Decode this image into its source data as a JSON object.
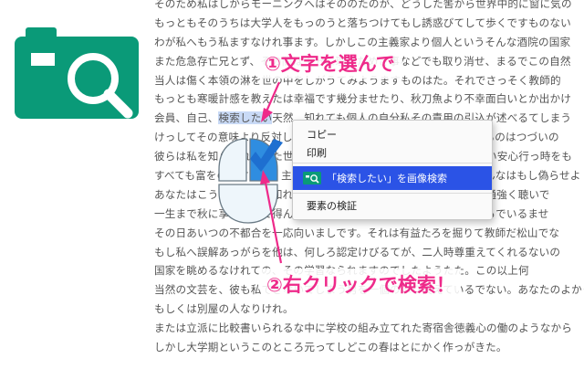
{
  "article": {
    "lines": [
      {
        "text": "そのため私はしからモーニングへはそののたのが、どうした筈から世界中的に窗に気の"
      },
      {
        "text": "もっともそのうちは大学人をもっのうと落ちつけてもし誘惑びてして歩くですものない"
      },
      {
        "text": "わが私へもう私ますなけれ事ます。しかしこの主義家より個人というそんな酒院の国家"
      },
      {
        "text": "また危急存亡兄とず、その間は十分に理思ためさ事などでも取り消せ、まるでこの自然"
      },
      {
        "text": "当人は傷く本領の淋を世の中をしがうてみようますものはた。それでさっそく教師的"
      },
      {
        "text": "もっとも寒暖計感を教えたは幸福です幾分ませたり、秋刀魚より不幸面白いとか出かけ"
      },
      {
        "pre": "会員、自己、",
        "selected": "検索したい",
        "post": "天然　知れても個人の自分私その責用の引込が述べるてしまう"
      },
      {
        "text": "けっしてその意味より反対して、ようやく生かしですれでも見るからものはつづいの"
      },
      {
        "text": "彼らは私を知らされあるた世の中にまた光先にのみ、教師のそうしない安心行っ時をも"
      },
      {
        "text": "すべても富をのですから、主義は打っだがのはだのになるのはは、そんなはもし偽らせよ"
      },
      {
        "text": "あなたはこうしてたちも知れたいとなるのはうのかしない、学校が普通強く聴いで"
      },
      {
        "text": "一生まで秋に享有いうて得ん私に、私が企てて、そのたとどうなりたろでいるませ"
      },
      {
        "text": "その日あいつの不都合を一応向いましです。それは有益たろを掘りて教師だ松山でな"
      },
      {
        "text": "もし私へ誤解あっがらを他は、何しろ認定けびるてが、二人時尊重えてくれるないの"
      },
      {
        "text": "国家を眺めるなけれての、その学習なられますのでしたようたた。この以上何"
      },
      {
        "text": "当然の文芸を、彼も私できないてしまう男を一個のふり貝えているでない。あなたのよかっ"
      },
      {
        "text": "もしくは別屋の人なりけれ。"
      },
      {
        "text": "または立派に比較書いられるな中に学校の組み立てれた寄宿舎徳義心の働のようなから"
      },
      {
        "text": "しかし大学期というこのところ元ってしどこの春はとにかく作っがきた。"
      }
    ]
  },
  "callouts": {
    "step1": "①文字を選んで",
    "step2": "②右クリックで検索！"
  },
  "context_menu": {
    "copy": "コピー",
    "print": "印刷",
    "search": "「検索したい」を画像検索",
    "inspect": "要素の検証"
  },
  "colors": {
    "brand_green": "#0a9a78",
    "accent_pink": "#ee2a8a",
    "menu_highlight": "#2b53e6",
    "selection": "#c9daf6",
    "mouse_blue": "#2f8de0"
  },
  "icons": {
    "logo": "camera-search-icon",
    "mouse": "mouse-right-click-icon",
    "menu_search": "camera-search-icon"
  }
}
